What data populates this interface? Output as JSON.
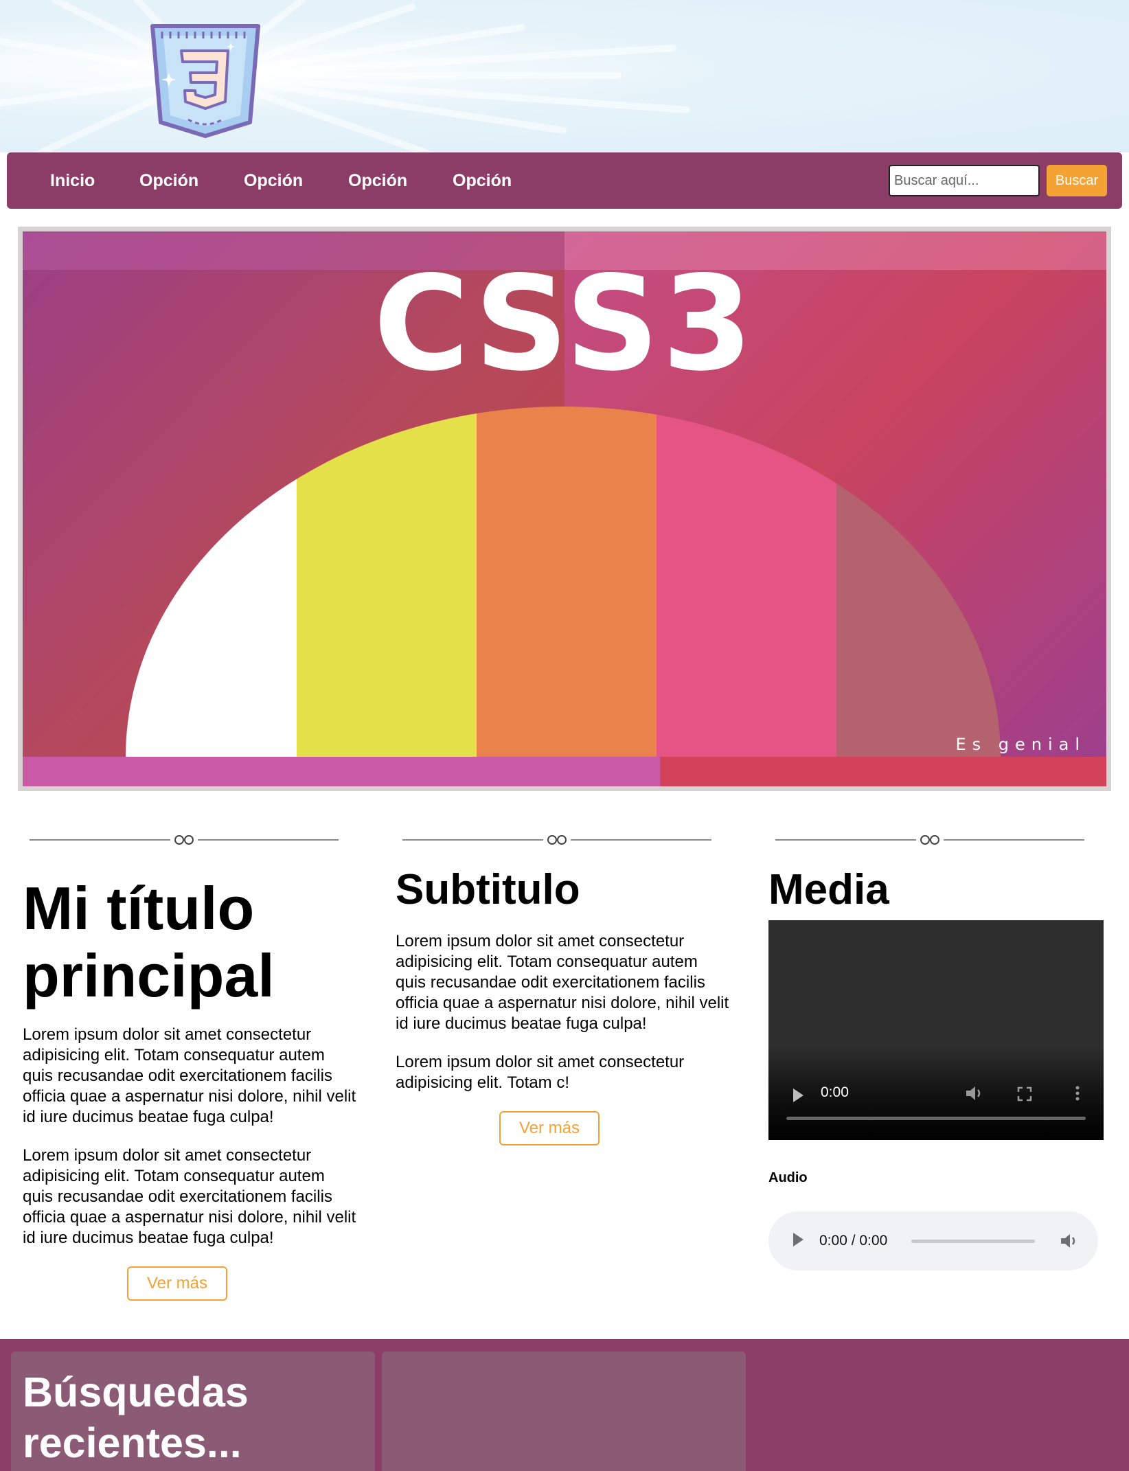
{
  "nav": {
    "items": [
      "Inicio",
      "Opción",
      "Opción",
      "Opción",
      "Opción"
    ],
    "search_placeholder": "Buscar aquí...",
    "search_button": "Buscar"
  },
  "hero": {
    "title": "CSS3",
    "tagline": "Es genial"
  },
  "columns": [
    {
      "heading": "Mi título principal",
      "paragraphs": [
        "Lorem ipsum dolor sit amet consectetur adipisicing elit. Totam consequatur autem quis recusandae odit exercitationem facilis officia quae a aspernatur nisi dolore, nihil velit id iure ducimus beatae fuga culpa!",
        "Lorem ipsum dolor sit amet consectetur adipisicing elit. Totam consequatur autem quis recusandae odit exercitationem facilis officia quae a aspernatur nisi dolore, nihil velit id iure ducimus beatae fuga culpa!"
      ],
      "button": "Ver más"
    },
    {
      "heading": "Subtitulo",
      "paragraphs": [
        "Lorem ipsum dolor sit amet consectetur adipisicing elit. Totam consequatur autem quis recusandae odit exercitationem facilis officia quae a aspernatur nisi dolore, nihil velit id iure ducimus beatae fuga culpa!",
        "Lorem ipsum dolor sit amet consectetur adipisicing elit. Totam c!"
      ],
      "button": "Ver más"
    },
    {
      "heading": "Media",
      "video_time": "0:00",
      "audio_label": "Audio",
      "audio_time": "0:00 / 0:00"
    }
  ],
  "footer": {
    "title": "Búsquedas recientes..."
  },
  "colors": {
    "nav_bg": "#8b3c67",
    "accent": "#f4a234",
    "footer_box": "#8b5a75"
  },
  "icons": [
    "css3-logo-icon",
    "ornament-divider-icon",
    "play-icon",
    "volume-icon",
    "fullscreen-icon",
    "more-vert-icon"
  ]
}
